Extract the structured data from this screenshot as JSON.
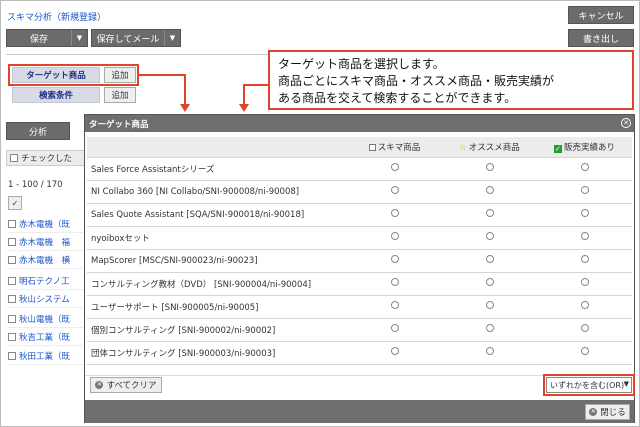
{
  "header": {
    "title": "スキマ分析（新規登録）",
    "cancel_label": "キャンセル",
    "save_label": "保存",
    "save_mail_label": "保存してメール",
    "export_label": "書き出し"
  },
  "conditions": {
    "target_label": "ターゲット商品",
    "search_label": "検索条件",
    "add_label": "追加",
    "add_label2": "追加"
  },
  "background": {
    "analyze_label": "分析",
    "checked_label": "チェックした",
    "range": "1 - 100 / 170",
    "check_mark": "✓",
    "rows": [
      "赤木電機（既",
      "赤木電機　福",
      "赤木電機　横",
      "明石テクノ工",
      "秋山システム",
      "秋山電機（既",
      "秋吉工業（既",
      "秋田工業（既"
    ]
  },
  "callout": {
    "line1": "ターゲット商品を選択します。",
    "line2": "商品ごとにスキマ商品・オススメ商品・販売実績が",
    "line3": "ある商品を交えて検索することができます。"
  },
  "modal": {
    "title": "ターゲット商品",
    "columns": {
      "gap": "スキマ商品",
      "recommend": "オススメ商品",
      "sales": "販売実績あり"
    },
    "products": [
      "Sales Force Assistantシリーズ",
      "NI Collabo 360 [NI Collabo/SNI-900008/ni-90008]",
      "Sales Quote Assistant [SQA/SNI-900018/ni-90018]",
      "nyoiboxセット",
      "MapScorer [MSC/SNI-900023/ni-90023]",
      "コンサルティング教材（DVD） [SNI-900004/ni-90004]",
      "ユーザーサポート [SNI-900005/ni-90005]",
      "個別コンサルティング [SNI-900002/ni-90002]",
      "団体コンサルティング [SNI-900003/ni-90003]"
    ],
    "clear_label": "すべてクリア",
    "select_value": "いずれかを含む(OR)",
    "close_label": "閉じる"
  },
  "colors": {
    "accent_red": "#e0452c",
    "header_gray": "#6e6e6e",
    "link_blue": "#1a55c8"
  }
}
